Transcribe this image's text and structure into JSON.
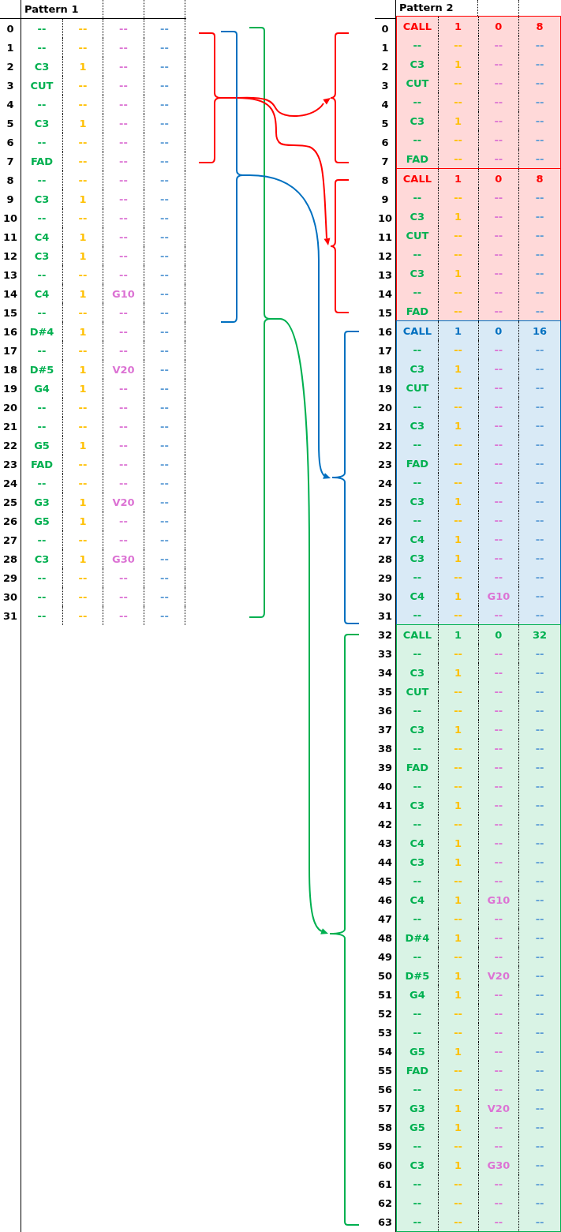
{
  "pattern_1": {
    "title": "Pattern 1",
    "rows": [
      {
        "number": "0",
        "cells": [
          "--",
          "--",
          "--",
          "--"
        ]
      },
      {
        "number": "1",
        "cells": [
          "--",
          "--",
          "--",
          "--"
        ]
      },
      {
        "number": "2",
        "cells": [
          "C3",
          "1",
          "--",
          "--"
        ]
      },
      {
        "number": "3",
        "cells": [
          "CUT",
          "--",
          "--",
          "--"
        ]
      },
      {
        "number": "4",
        "cells": [
          "--",
          "--",
          "--",
          "--"
        ]
      },
      {
        "number": "5",
        "cells": [
          "C3",
          "1",
          "--",
          "--"
        ]
      },
      {
        "number": "6",
        "cells": [
          "--",
          "--",
          "--",
          "--"
        ]
      },
      {
        "number": "7",
        "cells": [
          "FAD",
          "--",
          "--",
          "--"
        ]
      },
      {
        "number": "8",
        "cells": [
          "--",
          "--",
          "--",
          "--"
        ]
      },
      {
        "number": "9",
        "cells": [
          "C3",
          "1",
          "--",
          "--"
        ]
      },
      {
        "number": "10",
        "cells": [
          "--",
          "--",
          "--",
          "--"
        ]
      },
      {
        "number": "11",
        "cells": [
          "C4",
          "1",
          "--",
          "--"
        ]
      },
      {
        "number": "12",
        "cells": [
          "C3",
          "1",
          "--",
          "--"
        ]
      },
      {
        "number": "13",
        "cells": [
          "--",
          "--",
          "--",
          "--"
        ]
      },
      {
        "number": "14",
        "cells": [
          "C4",
          "1",
          "G10",
          "--"
        ]
      },
      {
        "number": "15",
        "cells": [
          "--",
          "--",
          "--",
          "--"
        ]
      },
      {
        "number": "16",
        "cells": [
          "D#4",
          "1",
          "--",
          "--"
        ]
      },
      {
        "number": "17",
        "cells": [
          "--",
          "--",
          "--",
          "--"
        ]
      },
      {
        "number": "18",
        "cells": [
          "D#5",
          "1",
          "V20",
          "--"
        ]
      },
      {
        "number": "19",
        "cells": [
          "G4",
          "1",
          "--",
          "--"
        ]
      },
      {
        "number": "20",
        "cells": [
          "--",
          "--",
          "--",
          "--"
        ]
      },
      {
        "number": "21",
        "cells": [
          "--",
          "--",
          "--",
          "--"
        ]
      },
      {
        "number": "22",
        "cells": [
          "G5",
          "1",
          "--",
          "--"
        ]
      },
      {
        "number": "23",
        "cells": [
          "FAD",
          "--",
          "--",
          "--"
        ]
      },
      {
        "number": "24",
        "cells": [
          "--",
          "--",
          "--",
          "--"
        ]
      },
      {
        "number": "25",
        "cells": [
          "G3",
          "1",
          "V20",
          "--"
        ]
      },
      {
        "number": "26",
        "cells": [
          "G5",
          "1",
          "--",
          "--"
        ]
      },
      {
        "number": "27",
        "cells": [
          "--",
          "--",
          "--",
          "--"
        ]
      },
      {
        "number": "28",
        "cells": [
          "C3",
          "1",
          "G30",
          "--"
        ]
      },
      {
        "number": "29",
        "cells": [
          "--",
          "--",
          "--",
          "--"
        ]
      },
      {
        "number": "30",
        "cells": [
          "--",
          "--",
          "--",
          "--"
        ]
      },
      {
        "number": "31",
        "cells": [
          "--",
          "--",
          "--",
          "--"
        ]
      }
    ]
  },
  "diagram": {
    "sources": [
      {
        "color": "#ff0000"
      },
      {
        "color": "#0070c0"
      },
      {
        "color": "#00b050"
      }
    ],
    "arrows": [
      {
        "color": "#ff0000"
      },
      {
        "color": "#ff0000"
      },
      {
        "color": "#0070c0"
      },
      {
        "color": "#00b050"
      }
    ],
    "targets": [
      {
        "color": "#ff0000"
      },
      {
        "color": "#ff0000"
      },
      {
        "color": "#0070c0"
      },
      {
        "color": "#00b050"
      }
    ]
  },
  "pattern_2": {
    "title": "Pattern 2",
    "sections": [
      {
        "color": "#ff0000",
        "rows": [
          {
            "number": "0",
            "kind": "call",
            "cells": [
              "CALL",
              "1",
              "0",
              "8"
            ]
          },
          {
            "number": "1",
            "kind": "note",
            "cells": [
              "--",
              "--",
              "--",
              "--"
            ]
          },
          {
            "number": "2",
            "kind": "note",
            "cells": [
              "C3",
              "1",
              "--",
              "--"
            ]
          },
          {
            "number": "3",
            "kind": "note",
            "cells": [
              "CUT",
              "--",
              "--",
              "--"
            ]
          },
          {
            "number": "4",
            "kind": "note",
            "cells": [
              "--",
              "--",
              "--",
              "--"
            ]
          },
          {
            "number": "5",
            "kind": "note",
            "cells": [
              "C3",
              "1",
              "--",
              "--"
            ]
          },
          {
            "number": "6",
            "kind": "note",
            "cells": [
              "--",
              "--",
              "--",
              "--"
            ]
          },
          {
            "number": "7",
            "kind": "note",
            "cells": [
              "FAD",
              "--",
              "--",
              "--"
            ]
          }
        ]
      },
      {
        "color": "#ff0000",
        "rows": [
          {
            "number": "8",
            "kind": "call",
            "cells": [
              "CALL",
              "1",
              "0",
              "8"
            ]
          },
          {
            "number": "9",
            "kind": "note",
            "cells": [
              "--",
              "--",
              "--",
              "--"
            ]
          },
          {
            "number": "10",
            "kind": "note",
            "cells": [
              "C3",
              "1",
              "--",
              "--"
            ]
          },
          {
            "number": "11",
            "kind": "note",
            "cells": [
              "CUT",
              "--",
              "--",
              "--"
            ]
          },
          {
            "number": "12",
            "kind": "note",
            "cells": [
              "--",
              "--",
              "--",
              "--"
            ]
          },
          {
            "number": "13",
            "kind": "note",
            "cells": [
              "C3",
              "1",
              "--",
              "--"
            ]
          },
          {
            "number": "14",
            "kind": "note",
            "cells": [
              "--",
              "--",
              "--",
              "--"
            ]
          },
          {
            "number": "15",
            "kind": "note",
            "cells": [
              "FAD",
              "--",
              "--",
              "--"
            ]
          }
        ]
      },
      {
        "color": "#0070c0",
        "rows": [
          {
            "number": "16",
            "kind": "call",
            "cells": [
              "CALL",
              "1",
              "0",
              "16"
            ]
          },
          {
            "number": "17",
            "kind": "note",
            "cells": [
              "--",
              "--",
              "--",
              "--"
            ]
          },
          {
            "number": "18",
            "kind": "note",
            "cells": [
              "C3",
              "1",
              "--",
              "--"
            ]
          },
          {
            "number": "19",
            "kind": "note",
            "cells": [
              "CUT",
              "--",
              "--",
              "--"
            ]
          },
          {
            "number": "20",
            "kind": "note",
            "cells": [
              "--",
              "--",
              "--",
              "--"
            ]
          },
          {
            "number": "21",
            "kind": "note",
            "cells": [
              "C3",
              "1",
              "--",
              "--"
            ]
          },
          {
            "number": "22",
            "kind": "note",
            "cells": [
              "--",
              "--",
              "--",
              "--"
            ]
          },
          {
            "number": "23",
            "kind": "note",
            "cells": [
              "FAD",
              "--",
              "--",
              "--"
            ]
          },
          {
            "number": "24",
            "kind": "note",
            "cells": [
              "--",
              "--",
              "--",
              "--"
            ]
          },
          {
            "number": "25",
            "kind": "note",
            "cells": [
              "C3",
              "1",
              "--",
              "--"
            ]
          },
          {
            "number": "26",
            "kind": "note",
            "cells": [
              "--",
              "--",
              "--",
              "--"
            ]
          },
          {
            "number": "27",
            "kind": "note",
            "cells": [
              "C4",
              "1",
              "--",
              "--"
            ]
          },
          {
            "number": "28",
            "kind": "note",
            "cells": [
              "C3",
              "1",
              "--",
              "--"
            ]
          },
          {
            "number": "29",
            "kind": "note",
            "cells": [
              "--",
              "--",
              "--",
              "--"
            ]
          },
          {
            "number": "30",
            "kind": "note",
            "cells": [
              "C4",
              "1",
              "G10",
              "--"
            ]
          },
          {
            "number": "31",
            "kind": "note",
            "cells": [
              "--",
              "--",
              "--",
              "--"
            ]
          }
        ]
      },
      {
        "color": "#00b050",
        "rows": [
          {
            "number": "32",
            "kind": "call",
            "cells": [
              "CALL",
              "1",
              "0",
              "32"
            ]
          },
          {
            "number": "33",
            "kind": "note",
            "cells": [
              "--",
              "--",
              "--",
              "--"
            ]
          },
          {
            "number": "34",
            "kind": "note",
            "cells": [
              "C3",
              "1",
              "--",
              "--"
            ]
          },
          {
            "number": "35",
            "kind": "note",
            "cells": [
              "CUT",
              "--",
              "--",
              "--"
            ]
          },
          {
            "number": "36",
            "kind": "note",
            "cells": [
              "--",
              "--",
              "--",
              "--"
            ]
          },
          {
            "number": "37",
            "kind": "note",
            "cells": [
              "C3",
              "1",
              "--",
              "--"
            ]
          },
          {
            "number": "38",
            "kind": "note",
            "cells": [
              "--",
              "--",
              "--",
              "--"
            ]
          },
          {
            "number": "39",
            "kind": "note",
            "cells": [
              "FAD",
              "--",
              "--",
              "--"
            ]
          },
          {
            "number": "40",
            "kind": "note",
            "cells": [
              "--",
              "--",
              "--",
              "--"
            ]
          },
          {
            "number": "41",
            "kind": "note",
            "cells": [
              "C3",
              "1",
              "--",
              "--"
            ]
          },
          {
            "number": "42",
            "kind": "note",
            "cells": [
              "--",
              "--",
              "--",
              "--"
            ]
          },
          {
            "number": "43",
            "kind": "note",
            "cells": [
              "C4",
              "1",
              "--",
              "--"
            ]
          },
          {
            "number": "44",
            "kind": "note",
            "cells": [
              "C3",
              "1",
              "--",
              "--"
            ]
          },
          {
            "number": "45",
            "kind": "note",
            "cells": [
              "--",
              "--",
              "--",
              "--"
            ]
          },
          {
            "number": "46",
            "kind": "note",
            "cells": [
              "C4",
              "1",
              "G10",
              "--"
            ]
          },
          {
            "number": "47",
            "kind": "note",
            "cells": [
              "--",
              "--",
              "--",
              "--"
            ]
          },
          {
            "number": "48",
            "kind": "note",
            "cells": [
              "D#4",
              "1",
              "--",
              "--"
            ]
          },
          {
            "number": "49",
            "kind": "note",
            "cells": [
              "--",
              "--",
              "--",
              "--"
            ]
          },
          {
            "number": "50",
            "kind": "note",
            "cells": [
              "D#5",
              "1",
              "V20",
              "--"
            ]
          },
          {
            "number": "51",
            "kind": "note",
            "cells": [
              "G4",
              "1",
              "--",
              "--"
            ]
          },
          {
            "number": "52",
            "kind": "note",
            "cells": [
              "--",
              "--",
              "--",
              "--"
            ]
          },
          {
            "number": "53",
            "kind": "note",
            "cells": [
              "--",
              "--",
              "--",
              "--"
            ]
          },
          {
            "number": "54",
            "kind": "note",
            "cells": [
              "G5",
              "1",
              "--",
              "--"
            ]
          },
          {
            "number": "55",
            "kind": "note",
            "cells": [
              "FAD",
              "--",
              "--",
              "--"
            ]
          },
          {
            "number": "56",
            "kind": "note",
            "cells": [
              "--",
              "--",
              "--",
              "--"
            ]
          },
          {
            "number": "57",
            "kind": "note",
            "cells": [
              "G3",
              "1",
              "V20",
              "--"
            ]
          },
          {
            "number": "58",
            "kind": "note",
            "cells": [
              "G5",
              "1",
              "--",
              "--"
            ]
          },
          {
            "number": "59",
            "kind": "note",
            "cells": [
              "--",
              "--",
              "--",
              "--"
            ]
          },
          {
            "number": "60",
            "kind": "note",
            "cells": [
              "C3",
              "1",
              "G30",
              "--"
            ]
          },
          {
            "number": "61",
            "kind": "note",
            "cells": [
              "--",
              "--",
              "--",
              "--"
            ]
          },
          {
            "number": "62",
            "kind": "note",
            "cells": [
              "--",
              "--",
              "--",
              "--"
            ]
          },
          {
            "number": "63",
            "kind": "note",
            "cells": [
              "--",
              "--",
              "--",
              "--"
            ]
          }
        ]
      }
    ]
  }
}
